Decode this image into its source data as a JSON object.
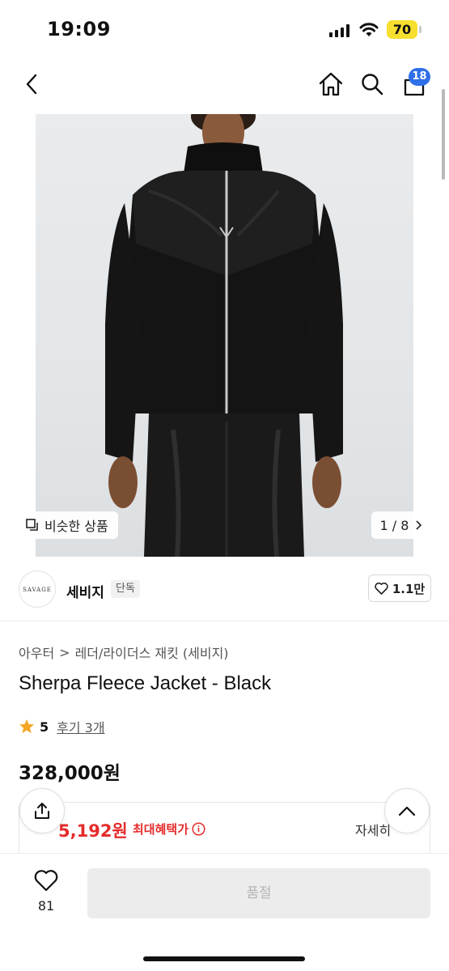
{
  "status_bar": {
    "time": "19:09",
    "battery": "70"
  },
  "header": {
    "cart_count": "18"
  },
  "gallery": {
    "similar_label": "비슷한 상품",
    "page_indicator": "1 / 8"
  },
  "brand": {
    "logo_text": "SAVAGE",
    "name": "세비지",
    "tag": "단독",
    "likes": "1.1만"
  },
  "product": {
    "breadcrumb": [
      "아우터",
      "레더/라이더스 재킷 (세비지)"
    ],
    "title": "Sherpa Fleece Jacket - Black",
    "rating": "5",
    "review_label": "후기 3개",
    "price": "328,000원"
  },
  "benefit": {
    "price": "5,192원",
    "label": "최대혜택가",
    "detail": "자세히"
  },
  "bottom_bar": {
    "wish_count": "81",
    "soldout_label": "품절"
  },
  "colors": {
    "accent_red": "#e52b2b",
    "badge_blue": "#2f6fe8",
    "battery_yellow": "#f6df2e",
    "star": "#f5a623"
  }
}
